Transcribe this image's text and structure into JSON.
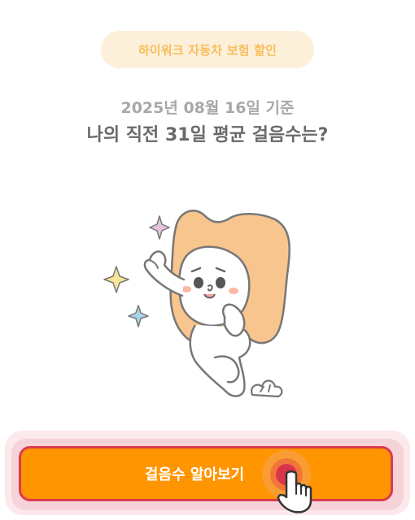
{
  "promo": {
    "label": "하이워크 자동차 보험 할인"
  },
  "header": {
    "date_line": "2025년 08월 16일 기준",
    "headline": "나의 직전 31일 평균 걸음수는?"
  },
  "illustration": {
    "name": "mascot-character",
    "colors": {
      "hair": "#f9c58e",
      "outline": "#777777",
      "blush": "#fbb8a2",
      "sparkle_yellow": "#f9e69a",
      "sparkle_blue": "#a9d3ea",
      "sparkle_pink": "#e6c3d9"
    }
  },
  "cta": {
    "label": "걸음수 알아보기",
    "color": "#ff9500",
    "border_color": "#dc3a4e",
    "tap_indicator_icon": "pointing-hand-icon"
  }
}
